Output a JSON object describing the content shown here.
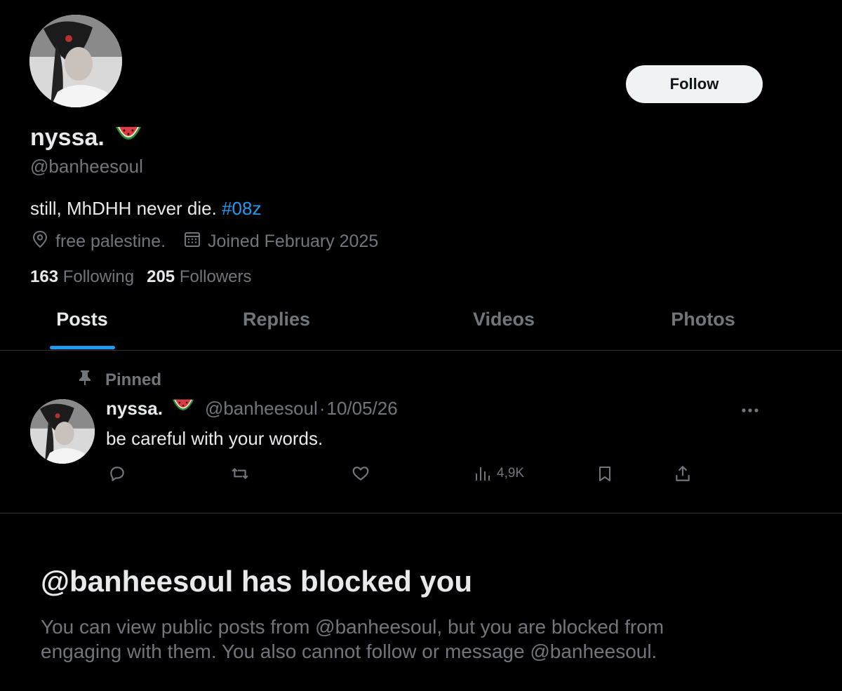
{
  "profile": {
    "display_name": "nyssa.",
    "name_emoji": "watermelon",
    "handle": "@banheesoul",
    "bio_text": "still, MhDHH never die.",
    "bio_hashtag": "#08z",
    "location": "free palestine.",
    "joined": "Joined February 2025",
    "following_count": "163",
    "following_label": "Following",
    "followers_count": "205",
    "followers_label": "Followers",
    "follow_button": "Follow"
  },
  "tabs": [
    {
      "label": "Posts",
      "active": true
    },
    {
      "label": "Replies",
      "active": false
    },
    {
      "label": "Videos",
      "active": false
    },
    {
      "label": "Photos",
      "active": false
    }
  ],
  "pinned_post": {
    "pinned_label": "Pinned",
    "author_name": "nyssa.",
    "author_handle": "@banheesoul",
    "separator": "·",
    "date": "10/05/26",
    "text": "be careful with your words.",
    "views": "4,9K",
    "icons": [
      "reply-icon",
      "retweet-icon",
      "like-icon",
      "views-icon",
      "bookmark-icon",
      "share-icon"
    ]
  },
  "blocked": {
    "title": "@banheesoul has blocked you",
    "body": "You can view public posts from @banheesoul, but you are blocked from engaging with them. You also cannot follow or message @banheesoul."
  },
  "colors": {
    "background": "#000000",
    "text": "#e7e9ea",
    "muted": "#71767b",
    "accent": "#1d9bf0",
    "divider": "#2f3336",
    "button_bg": "#eff3f4"
  }
}
